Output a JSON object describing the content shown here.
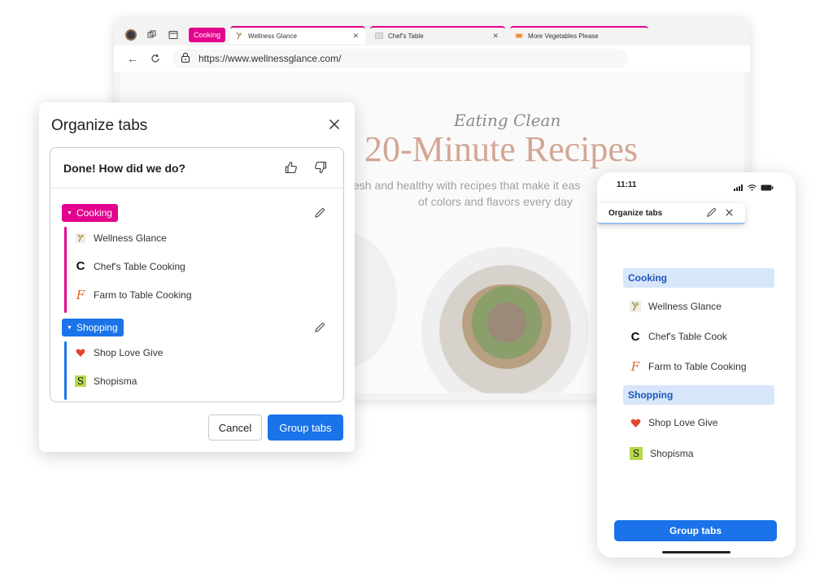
{
  "colors": {
    "cooking": "#e3008c",
    "shopping": "#1a73e8",
    "accent": "#1a73e8",
    "phone_group_bg": "#d8e6fb"
  },
  "browser": {
    "group_chip": "Cooking",
    "tabs": [
      {
        "title": "Wellness Glance",
        "icon": "wellness-glance-favicon"
      },
      {
        "title": "Chef's Table",
        "icon": "chefs-table-favicon"
      },
      {
        "title": "More Vegetables Please",
        "icon": "more-vegetables-favicon"
      }
    ],
    "url": "https://www.wellnessglance.com/",
    "page": {
      "eyebrow": "Eating Clean",
      "title": "20-Minute Recipes",
      "subtitle_line1": "esh and healthy with recipes that make it eas",
      "subtitle_line2": "of colors and flavors every day"
    }
  },
  "dialog": {
    "title": "Organize tabs",
    "feedback": "Done! How did we do?",
    "groups": [
      {
        "name": "Cooking",
        "color": "#e3008c",
        "items": [
          {
            "label": "Wellness Glance",
            "icon": "wellness-glance-favicon"
          },
          {
            "label": "Chef's Table Cooking",
            "icon": "chefs-table-favicon"
          },
          {
            "label": "Farm to Table Cooking",
            "icon": "farm-to-table-favicon"
          }
        ]
      },
      {
        "name": "Shopping",
        "color": "#1a73e8",
        "items": [
          {
            "label": "Shop Love Give",
            "icon": "shop-love-give-favicon"
          },
          {
            "label": "Shopisma",
            "icon": "shopisma-favicon"
          }
        ]
      }
    ],
    "cancel": "Cancel",
    "confirm": "Group tabs"
  },
  "phone": {
    "time": "11:11",
    "sheet_title": "Organize tabs",
    "groups": [
      {
        "name": "Cooking",
        "items": [
          "Wellness Glance",
          "Chef's Table Cook",
          "Farm to Table Cooking"
        ]
      },
      {
        "name": "Shopping",
        "items": [
          "Shop Love Give",
          "Shopisma"
        ]
      }
    ],
    "button": "Group tabs"
  }
}
